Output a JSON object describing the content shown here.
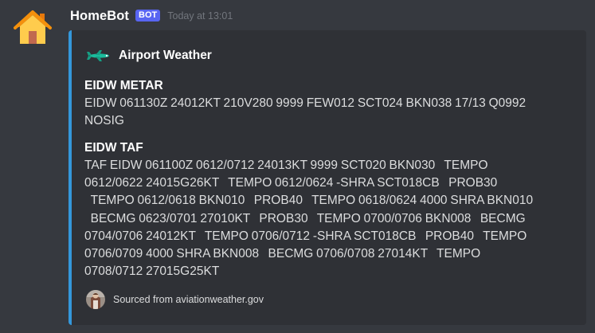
{
  "message": {
    "username": "HomeBot",
    "badge": "BOT",
    "timestamp": "Today at 13:01",
    "avatar_icon": "house-icon"
  },
  "embed": {
    "accent_color": "#3498db",
    "author": {
      "icon": "airplane-icon",
      "name": "Airport Weather"
    },
    "fields": [
      {
        "name": "EIDW METAR",
        "value": "EIDW 061130Z 24012KT 210V280 9999 FEW012 SCT024 BKN038 17/13 Q0992\nNOSIG"
      },
      {
        "name": "EIDW TAF",
        "value": "TAF EIDW 061100Z 0612/0712 24013KT 9999 SCT020 BKN030   TEMPO\n0612/0622 24015G26KT   TEMPO 0612/0624 -SHRA SCT018CB   PROB30\n  TEMPO 0612/0618 BKN010   PROB40   TEMPO 0618/0624 4000 SHRA BKN010\n  BECMG 0623/0701 27010KT   PROB30   TEMPO 0700/0706 BKN008   BECMG\n0704/0706 24012KT   TEMPO 0706/0712 -SHRA SCT018CB   PROB40   TEMPO\n0706/0709 4000 SHRA BKN008   BECMG 0706/0708 27014KT   TEMPO\n0708/0712 27015G25KT"
      }
    ],
    "footer": {
      "icon": "person-avatar-icon",
      "text": "Sourced from aviationweather.gov"
    }
  }
}
